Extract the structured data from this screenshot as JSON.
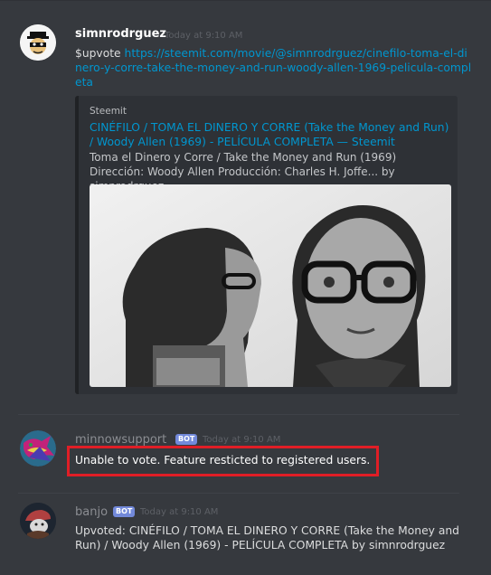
{
  "messages": [
    {
      "author": "simnrodrguez",
      "timestamp": "Today at 9:10 AM",
      "command": "$upvote",
      "link": "https://steemit.com/movie/@simnrodrguez/cinefilo-toma-el-dinero-y-corre-take-the-money-and-run-woody-allen-1969-pelicula-completa",
      "embed": {
        "provider": "Steemit",
        "title": "CINÉFILO / TOMA EL DINERO Y CORRE (Take the Money and Run) / Woody Allen (1969) - PELÍCULA COMPLETA — Steemit",
        "description": "Toma el Dinero y Corre / Take the Money and Run (1969) Dirección: Woody Allen Producción: Charles H. Joffe... by simnrodrguez"
      }
    },
    {
      "author": "minnowsupport",
      "bot_tag": "BOT",
      "timestamp": "Today at 9:10 AM",
      "text": "Unable to vote.  Feature resticted to registered users."
    },
    {
      "author": "banjo",
      "bot_tag": "BOT",
      "timestamp": "Today at 9:10 AM",
      "text": "Upvoted: CINÉFILO / TOMA EL DINERO Y CORRE (Take the Money and Run) / Woody Allen (1969) - PELÍCULA COMPLETA by simnrodrguez"
    }
  ],
  "colors": {
    "background": "#36393e",
    "link": "#0096cf",
    "bot_tag": "#7289da",
    "highlight": "#e01e26"
  }
}
